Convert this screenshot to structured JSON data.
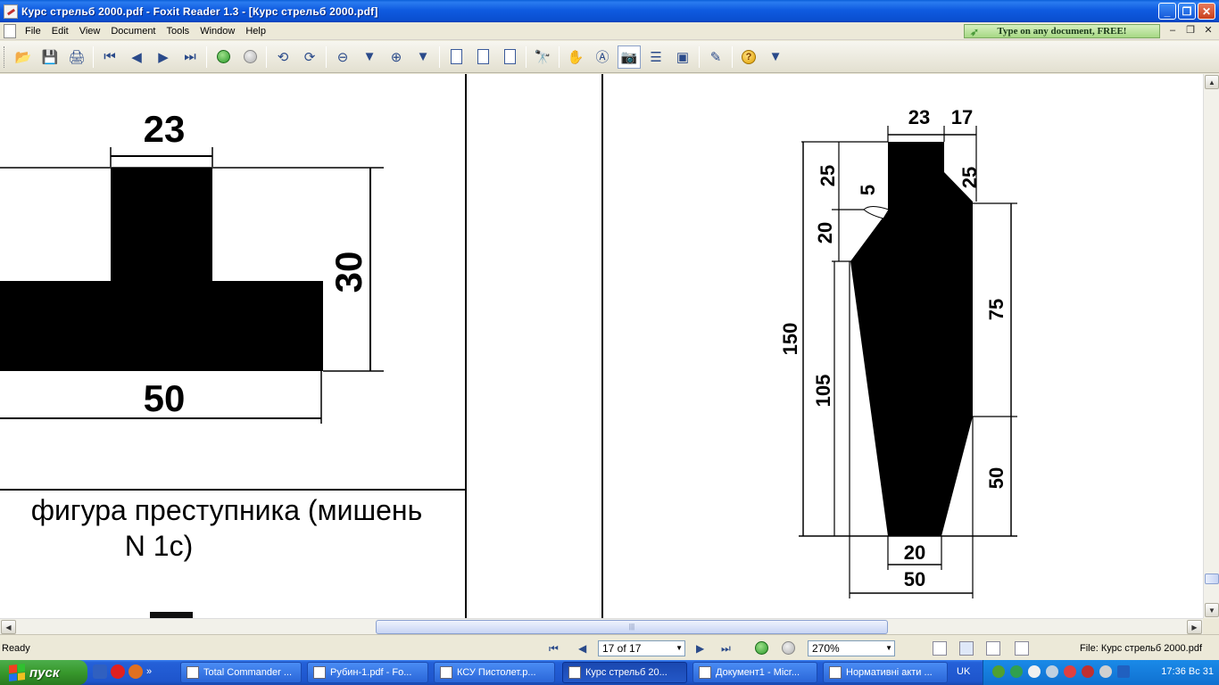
{
  "window": {
    "title": "Курс стрельб 2000.pdf - Foxit Reader 1.3 - [Курс стрельб 2000.pdf]"
  },
  "menu": {
    "items": [
      "File",
      "Edit",
      "View",
      "Document",
      "Tools",
      "Window",
      "Help"
    ],
    "promo": "Type on any document, FREE!"
  },
  "document": {
    "left_figure": {
      "dim_top": "23",
      "dim_right": "30",
      "dim_bottom": "50"
    },
    "caption_line1": "фигура преступника (мишень",
    "caption_line2": "N 1с)",
    "right_figure": {
      "dims": {
        "d23": "23",
        "d17": "17",
        "d25a": "25",
        "d25b": "25",
        "d5": "5",
        "d20a": "20",
        "d150": "150",
        "d105": "105",
        "d75": "75",
        "d50a": "50",
        "d20b": "20",
        "d50b": "50"
      }
    }
  },
  "statusbar": {
    "status": "Ready",
    "page_indicator": "17 of 17",
    "zoom": "270%",
    "file_label": "File: Курс стрельб 2000.pdf"
  },
  "taskbar": {
    "start": "пуск",
    "tasks": [
      "Total Commander ...",
      "Рубин-1.pdf - Fo...",
      "КСУ Пистолет.p...",
      "Курс стрельб 20...",
      "Документ1 - Micr...",
      "Нормативні акти ..."
    ],
    "lang": "UK",
    "clock": "17:36 Вс 31"
  }
}
